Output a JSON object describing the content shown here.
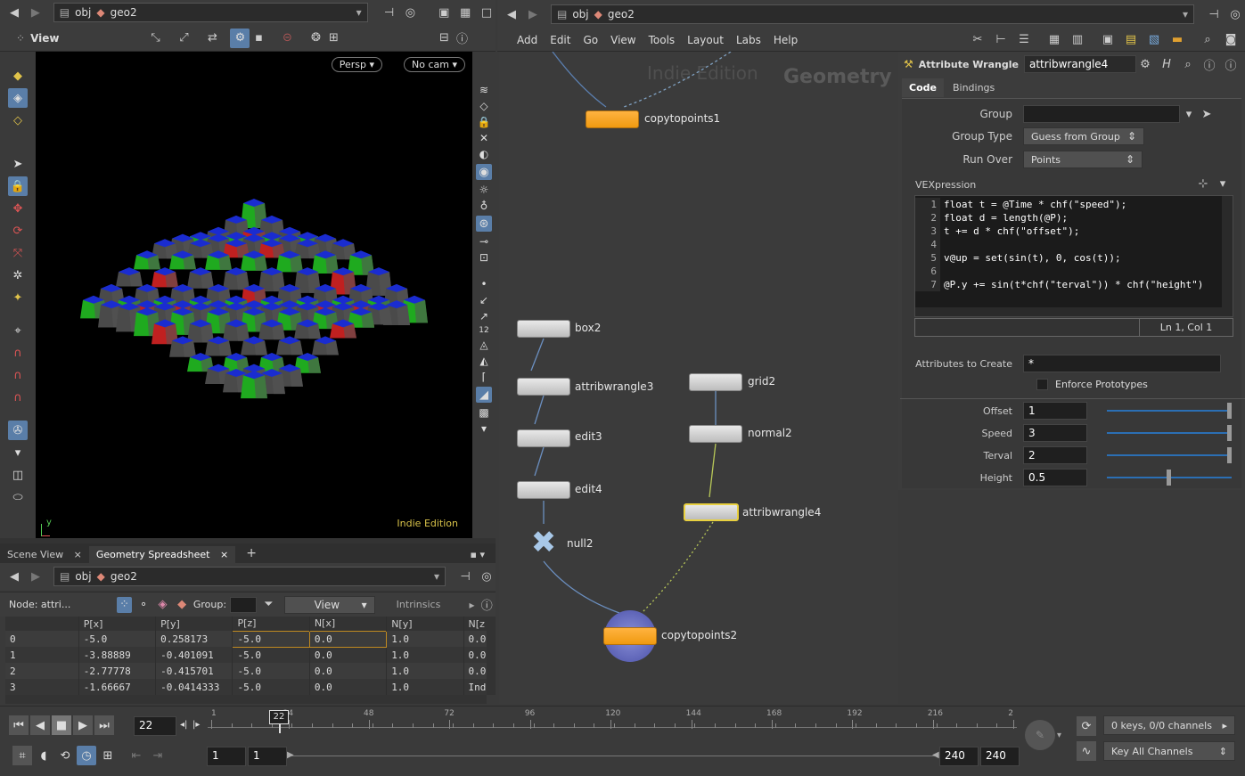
{
  "left_pane": {
    "path": {
      "obj": "obj",
      "geo": "geo2"
    },
    "view_label": "View",
    "persp_label": "Persp",
    "cam_label": "No cam",
    "watermark": "Indie Edition",
    "axis_y": "y",
    "axis_x": "x"
  },
  "spreadsheet": {
    "tabs": [
      "Scene View",
      "Geometry Spreadsheet"
    ],
    "path": {
      "obj": "obj",
      "geo": "geo2"
    },
    "node_label": "Node: attri...",
    "group_label": "Group:",
    "view_label": "View",
    "intrinsics_label": "Intrinsics",
    "columns": [
      "",
      "P[x]",
      "P[y]",
      "P[z]",
      "N[x]",
      "N[y]",
      "N[z"
    ],
    "rows": [
      [
        "0",
        "-5.0",
        "0.258173",
        "-5.0",
        "0.0",
        "1.0",
        "0.0"
      ],
      [
        "1",
        "-3.88889",
        "-0.401091",
        "-5.0",
        "0.0",
        "1.0",
        "0.0"
      ],
      [
        "2",
        "-2.77778",
        "-0.415701",
        "-5.0",
        "0.0",
        "1.0",
        "0.0"
      ],
      [
        "3",
        "-1.66667",
        "-0.0414333",
        "-5.0",
        "0.0",
        "1.0",
        "Indie"
      ]
    ]
  },
  "network": {
    "path": {
      "obj": "obj",
      "geo": "geo2"
    },
    "menu": [
      "Add",
      "Edit",
      "Go",
      "View",
      "Tools",
      "Layout",
      "Labs",
      "Help"
    ],
    "watermark": "Indie Edition",
    "context_label": "Geometry",
    "nodes": {
      "copytopoints1": "copytopoints1",
      "box2": "box2",
      "attribwrangle3": "attribwrangle3",
      "edit3": "edit3",
      "edit4": "edit4",
      "null2": "null2",
      "grid2": "grid2",
      "normal2": "normal2",
      "attribwrangle4": "attribwrangle4",
      "copytopoints2": "copytopoints2"
    }
  },
  "params": {
    "node_type": "Attribute Wrangle",
    "node_name": "attribwrangle4",
    "tabs": [
      "Code",
      "Bindings"
    ],
    "group_label": "Group",
    "group_value": "",
    "group_type_label": "Group Type",
    "group_type_value": "Guess from Group",
    "run_over_label": "Run Over",
    "run_over_value": "Points",
    "vex_label": "VEXpression",
    "code_lines": [
      {
        "n": "1",
        "t": "float t = @Time * chf(\"speed\");"
      },
      {
        "n": "2",
        "t": "float d = length(@P);"
      },
      {
        "n": "3",
        "t": "t += d * chf(\"offset\");"
      },
      {
        "n": "4",
        "t": ""
      },
      {
        "n": "5",
        "t": "v@up = set(sin(t), 0, cos(t));"
      },
      {
        "n": "6",
        "t": ""
      },
      {
        "n": "7",
        "t": "@P.y += sin(t*chf(\"terval\")) * chf(\"height\")"
      }
    ],
    "cursor_pos": "Ln 1, Col 1",
    "attrs_label": "Attributes to Create",
    "attrs_value": "*",
    "enforce_label": "Enforce Prototypes",
    "offset_label": "Offset",
    "offset_value": "1",
    "speed_label": "Speed",
    "speed_value": "3",
    "terval_label": "Terval",
    "terval_value": "2",
    "height_label": "Height",
    "height_value": "0.5"
  },
  "timeline": {
    "current_frame": "22",
    "marker_frame": "22",
    "tick_labels": [
      "1",
      "24",
      "48",
      "72",
      "96",
      "120",
      "144",
      "168",
      "192",
      "216",
      "2"
    ],
    "range_start": "1",
    "range_start2": "1",
    "range_end": "240",
    "range_end2": "240",
    "keys_label": "0 keys, 0/0 channels",
    "key_all_label": "Key All Channels"
  }
}
